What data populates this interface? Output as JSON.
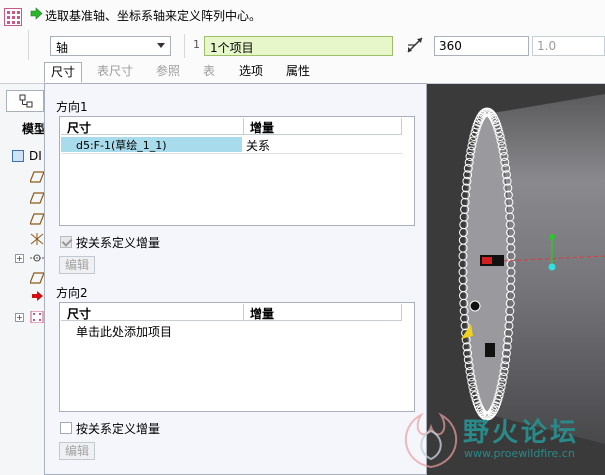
{
  "dashboard": {
    "prompt": "选取基准轴、坐标系轴来定义阵列中心。",
    "pattern_type": "轴",
    "direction1_number": "1",
    "direction1_collector": "1个项目",
    "angle_value": "360",
    "angle2_placeholder": "1.0"
  },
  "tabs": [
    {
      "label": "尺寸",
      "state": "active"
    },
    {
      "label": "表尺寸",
      "state": "disabled"
    },
    {
      "label": "参照",
      "state": "disabled"
    },
    {
      "label": "表",
      "state": "disabled"
    },
    {
      "label": "选项",
      "state": "enabled"
    },
    {
      "label": "属性",
      "state": "enabled"
    }
  ],
  "model_tree": {
    "title": "模型",
    "root": "DI"
  },
  "panel": {
    "direction1": {
      "label": "方向1",
      "columns": [
        "尺寸",
        "增量"
      ],
      "rows": [
        {
          "dimension": "d5:F-1(草绘_1_1)",
          "increment": "关系",
          "selected": true
        }
      ],
      "checkbox_label": "按关系定义增量",
      "checkbox_checked": true,
      "edit_button": "编辑"
    },
    "direction2": {
      "label": "方向2",
      "columns": [
        "尺寸",
        "增量"
      ],
      "rows": [
        {
          "dimension": "单击此处添加项目",
          "increment": ""
        }
      ],
      "checkbox_label": "按关系定义增量",
      "checkbox_checked": false,
      "edit_button": "编辑"
    }
  },
  "watermark": {
    "name": "野火论坛",
    "url": "www.proewildfire.cn"
  },
  "colors": {
    "collector_bg": "#e7f7c9",
    "selected_row": "#a8dcec",
    "graphics_bg": "#3a3a3a",
    "watermark": "#2a8a8a"
  }
}
